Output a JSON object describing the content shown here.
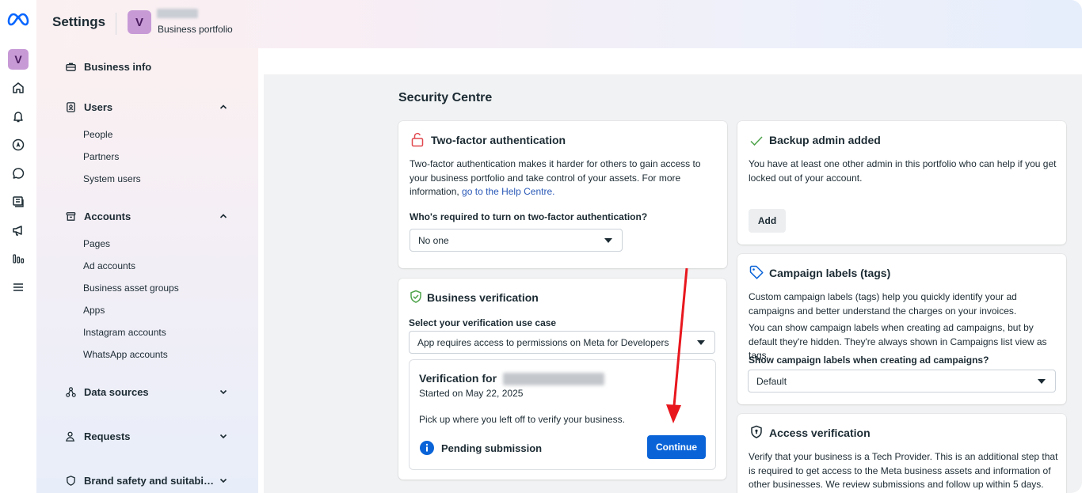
{
  "header": {
    "title": "Settings",
    "portfolio_avatar_letter": "V",
    "portfolio_subtitle": "Business portfolio"
  },
  "rail": {
    "avatar_letter": "V",
    "icons": [
      "meta-logo-icon",
      "home-icon",
      "bell-icon",
      "compass-icon",
      "chat-bubble-icon",
      "pages-icon",
      "megaphone-icon",
      "insights-icon",
      "menu-icon"
    ]
  },
  "nav": {
    "business_info": "Business info",
    "users": {
      "label": "Users",
      "items": [
        "People",
        "Partners",
        "System users"
      ]
    },
    "accounts": {
      "label": "Accounts",
      "items": [
        "Pages",
        "Ad accounts",
        "Business asset groups",
        "Apps",
        "Instagram accounts",
        "WhatsApp accounts"
      ]
    },
    "data_sources": "Data sources",
    "requests": "Requests",
    "brand_safety": "Brand safety and suitabi…"
  },
  "main": {
    "heading": "Security Centre",
    "two_factor": {
      "title": "Two-factor authentication",
      "description": "Two-factor authentication makes it harder for others to gain access to your business portfolio and take control of your assets. For more information,",
      "link": "go to the Help Centre.",
      "question": "Who's required to turn on two-factor authentication?",
      "select_value": "No one"
    },
    "business_verification": {
      "title": "Business verification",
      "use_case_label": "Select your verification use case",
      "use_case_value": "App requires access to permissions on Meta for Developers",
      "verification_for": "Verification for",
      "started": "Started on May 22, 2025",
      "pickup": "Pick up where you left off to verify your business.",
      "status": "Pending submission",
      "continue_label": "Continue"
    },
    "backup_admin": {
      "title": "Backup admin added",
      "description": "You have at least one other admin in this portfolio who can help if you get locked out of your account.",
      "add_label": "Add"
    },
    "campaign_labels": {
      "title": "Campaign labels (tags)",
      "description1": "Custom campaign labels (tags) help you quickly identify your ad campaigns and better understand the charges on your invoices.",
      "description2": "You can show campaign labels when creating ad campaigns, but by default they're hidden. They're always shown in Campaigns list view as tags.",
      "question": "Show campaign labels when creating ad campaigns?",
      "select_value": "Default"
    },
    "access_verification": {
      "title": "Access verification",
      "description": "Verify that your business is a Tech Provider. This is an additional step that is required to get access to the Meta business assets and information of other businesses. We review submissions and follow up within 5 days."
    }
  },
  "colors": {
    "accent_blue": "#0a64d8",
    "annotation_red": "#e8171e",
    "verified_green": "#4ea34a",
    "lock_red": "#e0484e"
  }
}
